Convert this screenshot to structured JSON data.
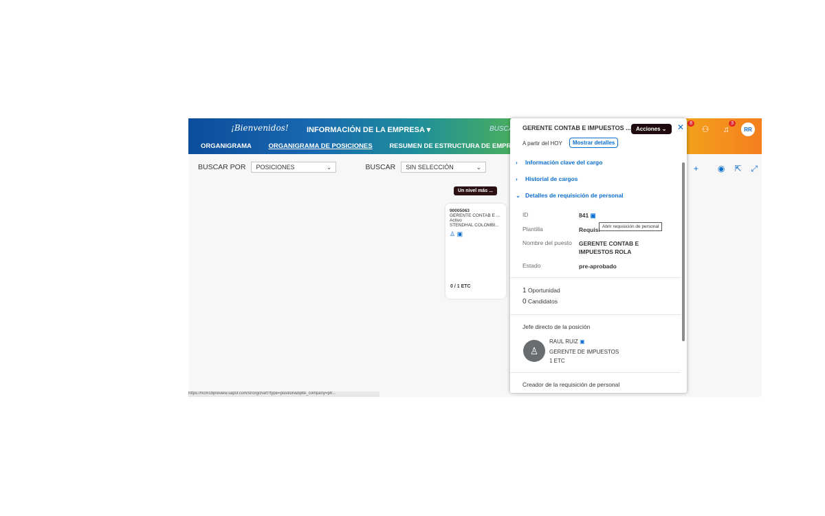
{
  "header": {
    "welcome": "¡Bienvenidos!",
    "module_menu": "INFORMACIÓN DE LA EMPRESA ▾",
    "search_hint": "BUSCA",
    "tabs": [
      "ORGANIGRAMA",
      "ORGANIGRAMA DE POSICIONES",
      "RESUMEN DE ESTRUCTURA DE EMPRESA"
    ],
    "notification_badges": [
      "8",
      "3"
    ],
    "user_initials": "RR"
  },
  "filters": {
    "buscar_por_label": "BUSCAR POR",
    "buscar_por_value": "POSICIONES",
    "buscar_label": "BUSCAR",
    "buscar_value": "SIN SELECCIÓN"
  },
  "chart": {
    "one_level_button": "Un nivel más ...",
    "card": {
      "id": "90005063",
      "title": "GERENTE CONTAB E ...",
      "status": "Activo",
      "company": "STENDHAL COLOMBI...",
      "etc": "0 / 1 ETC"
    }
  },
  "status_bar": "https://hcm19preview.sapsf.com/sf/orgchart?type=position&bplte_company=ph...",
  "panel": {
    "title": "GERENTE CONTAB E IMPUESTOS ...",
    "actions_button": "Acciones ⌄",
    "as_of": "A partir del HOY",
    "show_details": "Mostrar detalles",
    "sections": [
      "Información clave del cargo",
      "Historial de cargos",
      "Detalles de requisición de personal"
    ],
    "requisition": {
      "id_label": "ID",
      "id_value": "841",
      "template_label": "Plantilla",
      "template_value": "Requisi",
      "position_label": "Nombre del puesto",
      "position_value": "GERENTE CONTAB E IMPUESTOS ROLA",
      "state_label": "Estado",
      "state_value": "pre-aprobado"
    },
    "tooltip": "Abrir requisición de personal",
    "opportunities_count": "1",
    "opportunities_label": "Oportunidad",
    "candidates_count": "0",
    "candidates_label": "Candidatos",
    "manager_section": "Jefe directo de la posición",
    "manager": {
      "name": "RAUL RUIZ",
      "title": "GERENTE DE IMPUESTOS",
      "fte": "1 ETC"
    },
    "creator_section": "Creador de la requisición de personal"
  }
}
